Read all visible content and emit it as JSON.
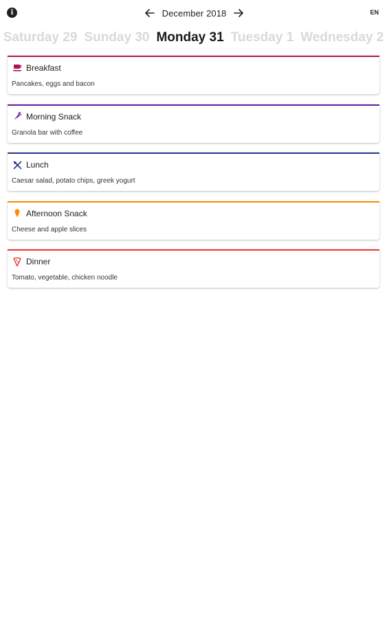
{
  "header": {
    "info_icon": "info-icon",
    "month": "December 2018",
    "prev_icon": "arrow-left-icon",
    "next_icon": "arrow-right-icon",
    "language": "EN"
  },
  "days": [
    {
      "label": "Saturday 29",
      "active": false
    },
    {
      "label": "Sunday 30",
      "active": false
    },
    {
      "label": "Monday 31",
      "active": true
    },
    {
      "label": "Tuesday 1",
      "active": false
    },
    {
      "label": "Wednesday 2",
      "active": false
    }
  ],
  "meals": [
    {
      "title": "Breakfast",
      "description": "Pancakes, eggs and bacon",
      "icon": "coffee-cup-icon",
      "color": "#ad1457"
    },
    {
      "title": "Morning Snack",
      "description": "Granola bar with coffee",
      "icon": "carrot-icon",
      "color": "#6a1b9a"
    },
    {
      "title": "Lunch",
      "description": "Caesar salad, potato chips, greek yogurt",
      "icon": "utensils-icon",
      "color": "#283593"
    },
    {
      "title": "Afternoon Snack",
      "description": "Cheese and apple slices",
      "icon": "ice-cream-icon",
      "color": "#fb8c00"
    },
    {
      "title": "Dinner",
      "description": "Tomato, vegetable, chicken noodle",
      "icon": "pizza-icon",
      "color": "#e53935"
    }
  ]
}
